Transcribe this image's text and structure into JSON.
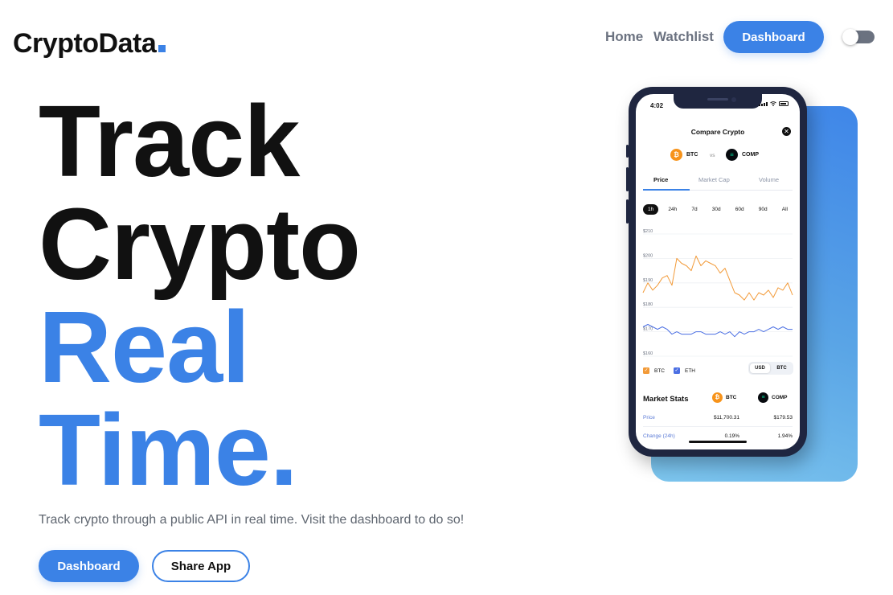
{
  "brand": {
    "name": "CryptoData",
    "accent": "#3b82e6"
  },
  "nav": {
    "home": "Home",
    "watchlist": "Watchlist",
    "dashboard": "Dashboard",
    "theme_toggle": "dark-mode-toggle"
  },
  "hero": {
    "line1": "Track",
    "line2": "Crypto",
    "line3": "Real",
    "line4": "Time.",
    "subtitle": "Track crypto through a public API in real time. Visit the dashboard to do so!",
    "cta_primary": "Dashboard",
    "cta_secondary": "Share App"
  },
  "phone": {
    "status_time": "4:02",
    "title": "Compare Crypto",
    "coin_a": "BTC",
    "vs": "vs",
    "coin_b": "COMP",
    "tabs": [
      "Price",
      "Market Cap",
      "Volume"
    ],
    "ranges": [
      "1h",
      "24h",
      "7d",
      "30d",
      "60d",
      "90d",
      "All"
    ],
    "legend": {
      "btc": "BTC",
      "eth": "ETH"
    },
    "currency": [
      "USD",
      "BTC"
    ],
    "market_stats": {
      "title": "Market Stats",
      "coin_a": "BTC",
      "coin_b": "COMP",
      "rows": [
        {
          "label": "Price",
          "a": "$11,700.31",
          "b": "$179.53"
        },
        {
          "label": "Change (24h)",
          "a": "0.19%",
          "b": "1.94%"
        }
      ]
    }
  },
  "chart_data": {
    "type": "line",
    "ylim": [
      160,
      210
    ],
    "y_ticks": [
      "$210",
      "$200",
      "$190",
      "$180",
      "$170",
      "$160"
    ],
    "series": [
      {
        "name": "BTC",
        "color": "#f29a38",
        "values": [
          186,
          190,
          187,
          189,
          192,
          193,
          189,
          200,
          198,
          197,
          195,
          201,
          197,
          199,
          198,
          197,
          194,
          196,
          191,
          186,
          185,
          183,
          186,
          183,
          186,
          185,
          187,
          184,
          188,
          187,
          190,
          185
        ]
      },
      {
        "name": "ETH",
        "color": "#4b6fe3",
        "values": [
          172,
          173,
          172,
          171,
          172,
          171,
          169,
          170,
          169,
          169,
          169,
          170,
          170,
          169,
          169,
          169,
          170,
          169,
          170,
          168,
          170,
          169,
          170,
          170,
          171,
          170,
          171,
          172,
          171,
          172,
          171,
          171
        ]
      }
    ]
  },
  "colors": {
    "btc": "#f7931a",
    "comp": "#00d395",
    "card_gradient_top": "#3f86e8",
    "card_gradient_bottom": "#7dc6ee"
  }
}
